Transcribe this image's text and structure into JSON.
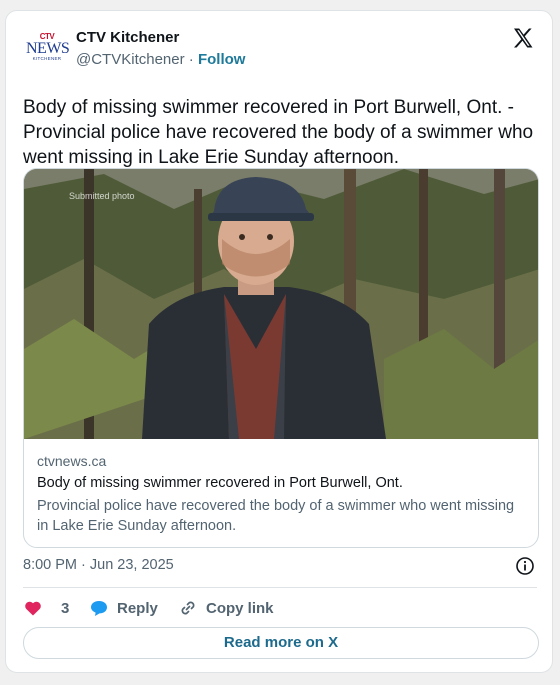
{
  "author": {
    "logo": {
      "top": "CTV",
      "middle": "NEWS",
      "bottom": "KITCHENER"
    },
    "name": "CTV Kitchener",
    "handle": "@CTVKitchener",
    "separator": " · ",
    "follow_label": "Follow"
  },
  "platform_icon": "x-logo-icon",
  "tweet": {
    "text": "Body of missing swimmer recovered in Port Burwell, Ont. - Provincial police have recovered the body of a swimmer who went missing in Lake Erie Sunday afternoon."
  },
  "link_card": {
    "photo_credit": "Submitted photo",
    "domain": "ctvnews.ca",
    "title": "Body of missing swimmer recovered in Port Burwell, Ont.",
    "description": "Provincial police have recovered the body of a swimmer who went missing in Lake Erie Sunday afternoon."
  },
  "timestamp": "8:00 PM · Jun 23, 2025",
  "actions": {
    "like_count": "3",
    "reply_label": "Reply",
    "copy_link_label": "Copy link"
  },
  "read_more_label": "Read more on X",
  "colors": {
    "heart": "#e0245e",
    "reply": "#1d9bf0",
    "link": "#1d7a9b"
  }
}
